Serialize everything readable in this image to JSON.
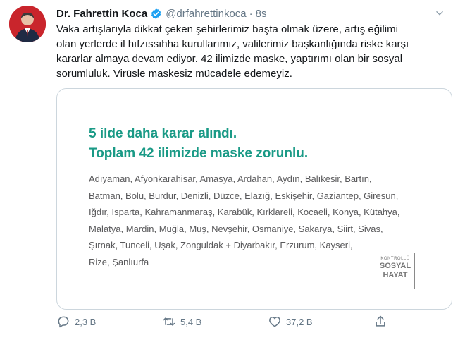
{
  "tweet": {
    "author_name": "Dr. Fahrettin Koca",
    "handle": "@drfahrettinkoca",
    "separator": "·",
    "time": "8s",
    "text_lines": [
      "Vaka artışlarıyla dikkat çeken şehirlerimiz başta olmak üzere, artış eğilimi",
      "olan yerlerde il hıfzıssıhha kurullarımız, valilerimiz başkanlığında riske karşı",
      "kararlar almaya devam ediyor. 42 ilimizde maske, yaptırımı olan bir sosyal",
      "sorumluluk. Virüsle maskesiz mücadele edemeyiz."
    ]
  },
  "card": {
    "headline_lines": [
      "5 ilde daha karar alındı.",
      "Toplam 42 ilimizde maske zorunlu."
    ],
    "city_lines": [
      "Adıyaman, Afyonkarahisar, Amasya, Ardahan, Aydın, Balıkesir, Bartın,",
      "Batman, Bolu, Burdur, Denizli, Düzce, Elazığ, Eskişehir, Gaziantep, Giresun,",
      "Iğdır, Isparta, Kahramanmaraş, Karabük, Kırklareli, Kocaeli, Konya, Kütahya,",
      "Malatya, Mardin, Muğla, Muş, Nevşehir, Osmaniye, Sakarya, Siirt, Sivas,",
      "Şırnak, Tunceli, Uşak, Zonguldak + Diyarbakır, Erzurum, Kayseri,",
      "Rize, Şanlıurfa"
    ],
    "badge": [
      "KONTROLLÜ",
      "SOSYAL",
      "HAYAT"
    ],
    "accent_color": "#1a9a86"
  },
  "actions": {
    "reply_count": "2,3 B",
    "retweet_count": "5,4 B",
    "like_count": "37,2 B"
  },
  "colors": {
    "verified": "#1da1f2",
    "muted": "#657786"
  }
}
